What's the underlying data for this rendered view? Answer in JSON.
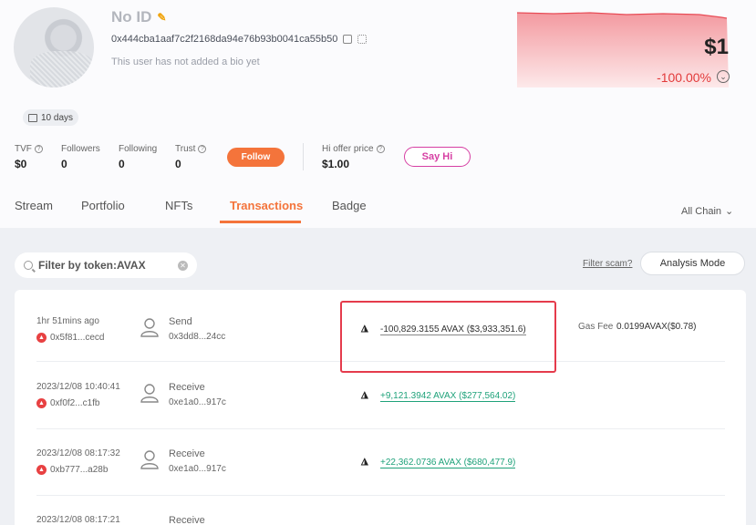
{
  "profile": {
    "name": "No ID",
    "address": "0x444cba1aaf7c2f2168da94e76b93b0041ca55b50",
    "bio": "This user has not added a bio yet",
    "days": "10 days"
  },
  "stats": {
    "tvf_label": "TVF",
    "tvf_value": "$0",
    "followers_label": "Followers",
    "followers_value": "0",
    "following_label": "Following",
    "following_value": "0",
    "trust_label": "Trust",
    "trust_value": "0",
    "follow_button": "Follow",
    "hi_offer_label": "Hi offer price",
    "hi_offer_value": "$1.00",
    "say_hi_button": "Say Hi"
  },
  "price_card": {
    "price": "$1",
    "change": "-100.00%",
    "accent_color": "#e23a3a"
  },
  "tabs": [
    {
      "label": "Stream"
    },
    {
      "label": "Portfolio"
    },
    {
      "label": "NFTs"
    },
    {
      "label": "Transactions",
      "active": true
    },
    {
      "label": "Badge"
    }
  ],
  "chain_filter": {
    "label": "All Chain"
  },
  "toolbar": {
    "search_text": "Filter by token:AVAX",
    "filter_scam": "Filter scam?",
    "analysis_mode": "Analysis Mode"
  },
  "transactions": [
    {
      "time": "1hr 51mins ago",
      "hash": "0x5f81...cecd",
      "kind": "Send",
      "counterparty": "0x3dd8...24cc",
      "amount": "-100,829.3155 AVAX ($3,933,351.6)",
      "direction": "out",
      "gas_label": "Gas Fee",
      "gas_value": "0.0199AVAX($0.78)"
    },
    {
      "time": "2023/12/08 10:40:41",
      "hash": "0xf0f2...c1fb",
      "kind": "Receive",
      "counterparty": "0xe1a0...917c",
      "amount": "+9,121.3942 AVAX ($277,564.02)",
      "direction": "in"
    },
    {
      "time": "2023/12/08 08:17:32",
      "hash": "0xb777...a28b",
      "kind": "Receive",
      "counterparty": "0xe1a0...917c",
      "amount": "+22,362.0736 AVAX ($680,477.9)",
      "direction": "in"
    },
    {
      "time": "2023/12/08 08:17:21",
      "kind": "Receive"
    }
  ]
}
